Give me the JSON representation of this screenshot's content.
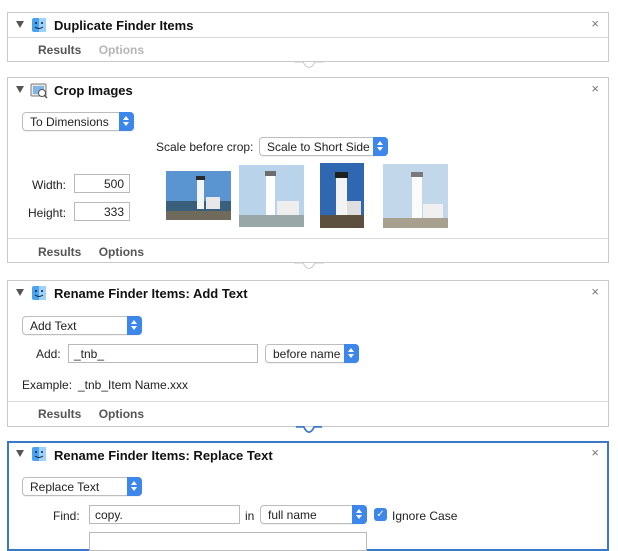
{
  "actions": [
    {
      "title": "Duplicate Finder Items",
      "icon": "finder-icon",
      "tabs": [
        {
          "label": "Results"
        },
        {
          "label": "Options"
        }
      ]
    },
    {
      "title": "Crop Images",
      "icon": "preview-icon",
      "mode": "To Dimensions",
      "scale_label": "Scale before crop:",
      "scale_value": "Scale to Short Side",
      "width_label": "Width:",
      "width_value": "500",
      "height_label": "Height:",
      "height_value": "333",
      "thumbnails": [
        "lighthouse-thumbnail",
        "lighthouse-thumbnail",
        "lighthouse-thumbnail",
        "lighthouse-thumbnail"
      ],
      "tabs": [
        {
          "label": "Results"
        },
        {
          "label": "Options"
        }
      ]
    },
    {
      "title": "Rename Finder Items: Add Text",
      "icon": "finder-icon",
      "mode": "Add Text",
      "add_label": "Add:",
      "add_value": "_tnb_",
      "position_value": "before name",
      "example_label": "Example:",
      "example_value": "_tnb_Item Name.xxx",
      "tabs": [
        {
          "label": "Results"
        },
        {
          "label": "Options"
        }
      ]
    },
    {
      "title": "Rename Finder Items: Replace Text",
      "icon": "finder-icon",
      "mode": "Replace Text",
      "find_label": "Find:",
      "find_value": "copy.",
      "in_label": "in",
      "in_value": "full name",
      "ignore_case_label": "Ignore Case",
      "ignore_case_checked": true
    }
  ],
  "colors": {
    "accent": "#3d86ea",
    "selected_border": "#3a78c8"
  }
}
